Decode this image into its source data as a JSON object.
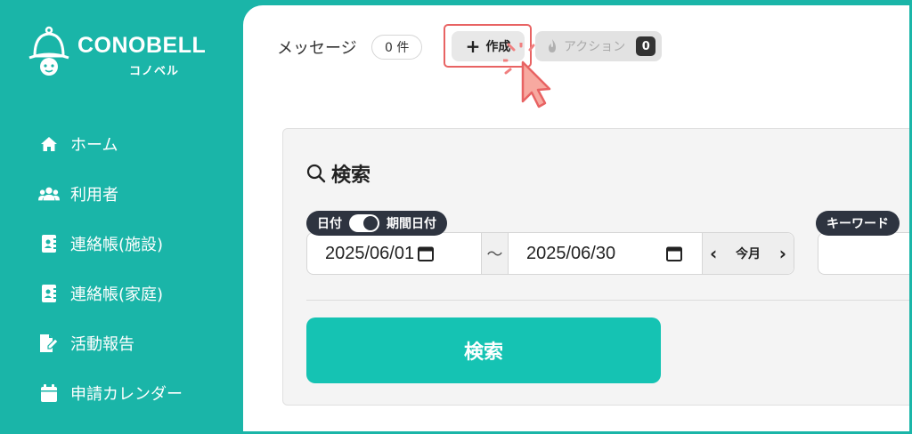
{
  "brand": {
    "name": "CONOBELL",
    "kana": "コノベル"
  },
  "sidebar": {
    "items": [
      {
        "label": "ホーム",
        "icon": "home-icon"
      },
      {
        "label": "利用者",
        "icon": "users-icon"
      },
      {
        "label": "連絡帳(施設)",
        "icon": "contact-card-icon"
      },
      {
        "label": "連絡帳(家庭)",
        "icon": "contact-card-icon"
      },
      {
        "label": "活動報告",
        "icon": "edit-document-icon"
      },
      {
        "label": "申請カレンダー",
        "icon": "calendar-icon"
      }
    ]
  },
  "header": {
    "title": "メッセージ",
    "count": "0 件",
    "create_label": "作成",
    "action_label": "アクション",
    "action_badge": "0"
  },
  "search": {
    "heading": "検索",
    "date_label": "日付",
    "period_label": "期間日付",
    "date_start": "2025/06/01",
    "separator": "～",
    "date_end": "2025/06/30",
    "month_label": "今月",
    "keyword_label": "キーワード",
    "keyword_value": "",
    "submit_label": "検索"
  },
  "colors": {
    "brand_teal": "#1ab5a8",
    "button_teal": "#15c3b3",
    "highlight_red": "#e86363",
    "label_dark": "#2e3440"
  }
}
